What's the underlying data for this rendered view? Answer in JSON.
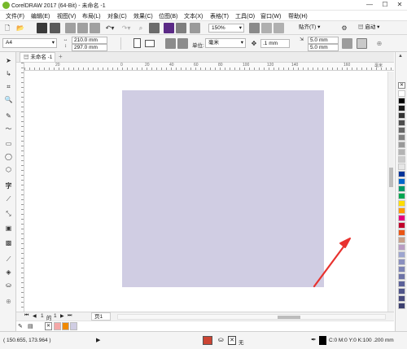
{
  "window": {
    "title": "CorelDRAW 2017 (64-Bit) - 未命名 -1",
    "minimize": "—",
    "maximize": "☐",
    "close": "✕"
  },
  "menu": [
    "文件(F)",
    "编辑(E)",
    "视图(V)",
    "布局(L)",
    "对象(C)",
    "效果(C)",
    "位图(B)",
    "文本(X)",
    "表格(T)",
    "工具(O)",
    "窗口(W)",
    "帮助(H)"
  ],
  "toolbar": {
    "zoom": "150%",
    "snap": "贴齐(T)",
    "launch": "启动"
  },
  "property_bar": {
    "page_size": "A4",
    "width": "210.0 mm",
    "height": "297.0 mm",
    "units_label": "单位:",
    "units": "毫米",
    "nudge": ".1 mm",
    "dup_x": "5.0 mm",
    "dup_y": "5.0 mm"
  },
  "document_tab": {
    "name": "未命名 -1",
    "add": "+"
  },
  "ruler": {
    "h_ticks": [
      "20",
      "0",
      "20",
      "40",
      "60",
      "80",
      "100",
      "120",
      "140",
      "160"
    ],
    "unit": "毫米"
  },
  "page_nav": {
    "first": "⏮",
    "prev": "◀",
    "page_num": "1",
    "of": "的",
    "page_total": "1",
    "next": "▶",
    "last": "⏭",
    "tab": "页1"
  },
  "status": {
    "coords": "( 150.655, 173.964 )",
    "fill_none": "无",
    "outline_text": "C:0 M:0 Y:0 K:100 .200 mm"
  },
  "palette_colors": [
    "#ffffff",
    "#000000",
    "#1a1a1a",
    "#333333",
    "#4d4d4d",
    "#666666",
    "#808080",
    "#999999",
    "#b3b3b3",
    "#cccccc",
    "#e6e6e6",
    "#003399",
    "#0066cc",
    "#009966",
    "#00a651",
    "#ffde00",
    "#ff9900",
    "#e4007f",
    "#c1002a",
    "#ea5514",
    "#c8a08a",
    "#b89cc2",
    "#9da5cf",
    "#8a8fbf",
    "#7c83b5",
    "#6d73a7",
    "#5b6199",
    "#50558a",
    "#474a7d",
    "#3d4070"
  ],
  "colorbar_swatches": [
    "#f4a7a7",
    "#f08a00",
    "#d0cde3"
  ],
  "page_fill": "#d0cde3",
  "annotation_color": "#e8322f"
}
